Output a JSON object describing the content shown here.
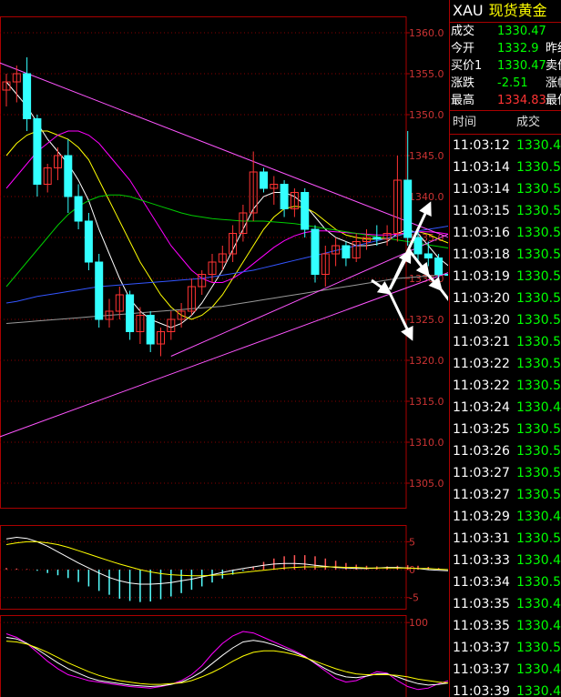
{
  "symbol": {
    "code": "XAU",
    "name": "现货黄金"
  },
  "quote": {
    "rows": [
      {
        "label": "成交",
        "value": "1330.47",
        "color": "#00ff00",
        "label2": ""
      },
      {
        "label": "今开",
        "value": "1332.9",
        "color": "#00ff00",
        "label2": "昨结"
      },
      {
        "label": "买价1",
        "value": "1330.47",
        "color": "#00ff00",
        "label2": "卖价"
      },
      {
        "label": "涨跌",
        "value": "-2.51",
        "color": "#00ff00",
        "label2": "涨幅"
      },
      {
        "label": "最高",
        "value": "1334.83",
        "color": "#ff3333",
        "label2": "最低"
      }
    ]
  },
  "ticks_header": {
    "time": "时间",
    "price": "成交"
  },
  "ticks": [
    {
      "time": "11:03:12",
      "price": "1330.4"
    },
    {
      "time": "11:03:14",
      "price": "1330.5"
    },
    {
      "time": "11:03:14",
      "price": "1330.5"
    },
    {
      "time": "11:03:15",
      "price": "1330.5"
    },
    {
      "time": "11:03:16",
      "price": "1330.5"
    },
    {
      "time": "11:03:18",
      "price": "1330.5"
    },
    {
      "time": "11:03:19",
      "price": "1330.5"
    },
    {
      "time": "11:03:20",
      "price": "1330.5"
    },
    {
      "time": "11:03:20",
      "price": "1330.5"
    },
    {
      "time": "11:03:21",
      "price": "1330.5"
    },
    {
      "time": "11:03:22",
      "price": "1330.5"
    },
    {
      "time": "11:03:22",
      "price": "1330.5"
    },
    {
      "time": "11:03:24",
      "price": "1330.4"
    },
    {
      "time": "11:03:25",
      "price": "1330.5"
    },
    {
      "time": "11:03:26",
      "price": "1330.5"
    },
    {
      "time": "11:03:27",
      "price": "1330.5"
    },
    {
      "time": "11:03:27",
      "price": "1330.5"
    },
    {
      "time": "11:03:29",
      "price": "1330.4"
    },
    {
      "time": "11:03:31",
      "price": "1330.5"
    },
    {
      "time": "11:03:33",
      "price": "1330.4"
    },
    {
      "time": "11:03:34",
      "price": "1330.5"
    },
    {
      "time": "11:03:35",
      "price": "1330.4"
    },
    {
      "time": "11:03:35",
      "price": "1330.4"
    },
    {
      "time": "11:03:37",
      "price": "1330.5"
    },
    {
      "time": "11:03:37",
      "price": "1330.4"
    },
    {
      "time": "11:03:39",
      "price": "1330.4"
    }
  ],
  "chart_data": [
    {
      "type": "candlestick",
      "ylim": [
        1302,
        1362
      ],
      "y_ticks": [
        "1360.0",
        "1355.0",
        "1350.0",
        "1345.0",
        "1340.0",
        "1335.0",
        "1330.0",
        "1325.0",
        "1320.0",
        "1315.0",
        "1310.0",
        "1305.0"
      ],
      "y_tick_values": [
        1360,
        1355,
        1350,
        1345,
        1340,
        1335,
        1330,
        1325,
        1320,
        1315,
        1310,
        1305
      ],
      "colors": {
        "up": "#ff3333",
        "down": "#33ffff"
      },
      "candles": [
        {
          "o": 1353.0,
          "h": 1355.0,
          "l": 1351.0,
          "c": 1354.0
        },
        {
          "o": 1354.0,
          "h": 1356.0,
          "l": 1351.5,
          "c": 1355.0
        },
        {
          "o": 1355.0,
          "h": 1357.0,
          "l": 1348.0,
          "c": 1349.5
        },
        {
          "o": 1349.5,
          "h": 1350.0,
          "l": 1340.0,
          "c": 1341.5
        },
        {
          "o": 1341.5,
          "h": 1344.0,
          "l": 1340.5,
          "c": 1343.5
        },
        {
          "o": 1343.5,
          "h": 1346.0,
          "l": 1342.0,
          "c": 1345.0
        },
        {
          "o": 1345.0,
          "h": 1347.0,
          "l": 1338.0,
          "c": 1340.0
        },
        {
          "o": 1340.0,
          "h": 1341.5,
          "l": 1336.0,
          "c": 1337.0
        },
        {
          "o": 1337.0,
          "h": 1338.0,
          "l": 1331.0,
          "c": 1332.0
        },
        {
          "o": 1332.0,
          "h": 1333.0,
          "l": 1324.0,
          "c": 1325.0
        },
        {
          "o": 1325.0,
          "h": 1327.5,
          "l": 1324.0,
          "c": 1326.0
        },
        {
          "o": 1326.0,
          "h": 1329.0,
          "l": 1325.0,
          "c": 1328.0
        },
        {
          "o": 1328.0,
          "h": 1328.5,
          "l": 1322.5,
          "c": 1323.5
        },
        {
          "o": 1323.5,
          "h": 1326.5,
          "l": 1322.0,
          "c": 1325.5
        },
        {
          "o": 1325.5,
          "h": 1326.0,
          "l": 1321.0,
          "c": 1322.0
        },
        {
          "o": 1322.0,
          "h": 1324.0,
          "l": 1320.5,
          "c": 1323.5
        },
        {
          "o": 1323.5,
          "h": 1326.0,
          "l": 1322.5,
          "c": 1325.0
        },
        {
          "o": 1325.0,
          "h": 1327.0,
          "l": 1324.0,
          "c": 1326.0
        },
        {
          "o": 1326.0,
          "h": 1330.0,
          "l": 1325.5,
          "c": 1329.0
        },
        {
          "o": 1329.0,
          "h": 1331.0,
          "l": 1328.0,
          "c": 1330.5
        },
        {
          "o": 1330.5,
          "h": 1333.0,
          "l": 1329.5,
          "c": 1332.0
        },
        {
          "o": 1332.0,
          "h": 1334.0,
          "l": 1331.0,
          "c": 1333.0
        },
        {
          "o": 1333.0,
          "h": 1336.5,
          "l": 1332.0,
          "c": 1335.5
        },
        {
          "o": 1335.5,
          "h": 1339.0,
          "l": 1334.5,
          "c": 1338.0
        },
        {
          "o": 1338.0,
          "h": 1345.5,
          "l": 1337.0,
          "c": 1343.0
        },
        {
          "o": 1343.0,
          "h": 1343.5,
          "l": 1340.5,
          "c": 1341.0
        },
        {
          "o": 1341.0,
          "h": 1342.5,
          "l": 1339.0,
          "c": 1341.5
        },
        {
          "o": 1341.5,
          "h": 1342.0,
          "l": 1337.5,
          "c": 1338.5
        },
        {
          "o": 1338.5,
          "h": 1341.0,
          "l": 1337.5,
          "c": 1340.5
        },
        {
          "o": 1340.5,
          "h": 1341.0,
          "l": 1335.0,
          "c": 1336.0
        },
        {
          "o": 1336.0,
          "h": 1336.5,
          "l": 1329.5,
          "c": 1330.5
        },
        {
          "o": 1330.5,
          "h": 1334.0,
          "l": 1329.0,
          "c": 1333.0
        },
        {
          "o": 1333.0,
          "h": 1335.0,
          "l": 1331.5,
          "c": 1334.0
        },
        {
          "o": 1334.0,
          "h": 1334.5,
          "l": 1331.5,
          "c": 1332.5
        },
        {
          "o": 1332.5,
          "h": 1335.5,
          "l": 1332.0,
          "c": 1334.5
        },
        {
          "o": 1334.5,
          "h": 1336.0,
          "l": 1333.5,
          "c": 1335.0
        },
        {
          "o": 1335.0,
          "h": 1336.5,
          "l": 1334.0,
          "c": 1334.8
        },
        {
          "o": 1334.8,
          "h": 1336.5,
          "l": 1334.0,
          "c": 1335.5
        },
        {
          "o": 1335.5,
          "h": 1345.0,
          "l": 1334.5,
          "c": 1342.0
        },
        {
          "o": 1342.0,
          "h": 1348.0,
          "l": 1334.0,
          "c": 1335.0
        },
        {
          "o": 1335.0,
          "h": 1336.0,
          "l": 1332.0,
          "c": 1333.0
        },
        {
          "o": 1333.0,
          "h": 1334.5,
          "l": 1331.5,
          "c": 1332.5
        },
        {
          "o": 1332.5,
          "h": 1333.0,
          "l": 1330.0,
          "c": 1330.5
        },
        {
          "o": 1330.5,
          "h": 1331.0,
          "l": 1330.0,
          "c": 1330.47
        }
      ],
      "ma_lines": [
        {
          "color": "#ffffff",
          "values": [
            1354,
            1352.5,
            1351,
            1349,
            1347,
            1345.5,
            1344,
            1342,
            1339.5,
            1336,
            1333,
            1330,
            1327.5,
            1326,
            1325,
            1324.5,
            1324,
            1324.5,
            1325.5,
            1327,
            1329,
            1331,
            1333.5,
            1336,
            1338.5,
            1340,
            1340.5,
            1340.5,
            1340,
            1339,
            1337.5,
            1336,
            1335,
            1334.5,
            1334,
            1334,
            1334.2,
            1334.5,
            1335.5,
            1336,
            1335.5,
            1334,
            1332.5,
            1331.5
          ]
        },
        {
          "color": "#ffff00",
          "values": [
            1345,
            1346.5,
            1347.5,
            1348,
            1348,
            1347.5,
            1347,
            1346,
            1344.5,
            1342,
            1339.5,
            1337,
            1334.5,
            1332,
            1330,
            1328,
            1326.5,
            1325.5,
            1325,
            1325.5,
            1326.5,
            1328,
            1330,
            1332,
            1334,
            1336,
            1337.5,
            1338.5,
            1338.8,
            1338.7,
            1338,
            1337,
            1336,
            1335.3,
            1335,
            1334.8,
            1334.8,
            1334.9,
            1335.2,
            1335.6,
            1335.7,
            1335.4,
            1334.8,
            1334.3
          ]
        },
        {
          "color": "#ff00ff",
          "values": [
            1341,
            1342.5,
            1344,
            1345.5,
            1346.5,
            1347.5,
            1348,
            1348,
            1347.5,
            1346.5,
            1345,
            1343.5,
            1342,
            1340,
            1338,
            1336,
            1334,
            1332.5,
            1331,
            1330,
            1329.5,
            1329.5,
            1330,
            1330.8,
            1331.8,
            1332.8,
            1333.8,
            1334.6,
            1335.2,
            1335.6,
            1335.8,
            1335.8,
            1335.7,
            1335.6,
            1335.5,
            1335.4,
            1335.3,
            1335.3,
            1335.4,
            1335.6,
            1335.7,
            1335.7,
            1335.6,
            1335.4
          ]
        },
        {
          "color": "#00cc00",
          "values": [
            1329,
            1330.5,
            1332,
            1333.5,
            1335,
            1336.5,
            1337.8,
            1338.8,
            1339.5,
            1340,
            1340.2,
            1340.2,
            1340,
            1339.6,
            1339.2,
            1338.8,
            1338.4,
            1338,
            1337.7,
            1337.5,
            1337.3,
            1337.2,
            1337.1,
            1337,
            1337,
            1337,
            1336.9,
            1336.8,
            1336.7,
            1336.5,
            1336.3,
            1336.1,
            1335.9,
            1335.7,
            1335.5,
            1335.3,
            1335.1,
            1334.9,
            1334.7,
            1334.5,
            1334.3,
            1334.1,
            1333.9,
            1333.7
          ]
        },
        {
          "color": "#3355ff",
          "values": [
            1327,
            1327.2,
            1327.5,
            1327.8,
            1328,
            1328.2,
            1328.4,
            1328.6,
            1328.8,
            1329,
            1329.1,
            1329.2,
            1329.3,
            1329.4,
            1329.5,
            1329.6,
            1329.7,
            1329.8,
            1329.9,
            1330,
            1330.2,
            1330.4,
            1330.6,
            1330.8,
            1331,
            1331.3,
            1331.6,
            1331.9,
            1332.2,
            1332.5,
            1332.8,
            1333.1,
            1333.4,
            1333.7,
            1334,
            1334.3,
            1334.6,
            1334.9,
            1335.2,
            1335.5,
            1335.8,
            1336,
            1336.2,
            1336.4
          ]
        },
        {
          "color": "#999999",
          "values": [
            1324.5,
            1324.6,
            1324.7,
            1324.8,
            1324.9,
            1325,
            1325.1,
            1325.2,
            1325.3,
            1325.4,
            1325.5,
            1325.6,
            1325.7,
            1325.8,
            1325.9,
            1326,
            1326.1,
            1326.2,
            1326.3,
            1326.4,
            1326.5,
            1326.6,
            1326.8,
            1327,
            1327.2,
            1327.4,
            1327.6,
            1327.8,
            1328,
            1328.2,
            1328.4,
            1328.6,
            1328.8,
            1329,
            1329.2,
            1329.4,
            1329.6,
            1329.8,
            1330,
            1330.1,
            1330.2,
            1330.3,
            1330.4,
            1330.5
          ]
        }
      ],
      "trend_lines": [
        {
          "from": [
            -1,
            1356.5
          ],
          "to": [
            44,
            1334.5
          ],
          "color": "#ff55ff"
        },
        {
          "from": [
            -1,
            1310.5
          ],
          "to": [
            44,
            1331.2
          ],
          "color": "#ff55ff"
        },
        {
          "from": [
            16,
            1320.5
          ],
          "to": [
            44,
            1336.0
          ],
          "color": "#ff55ff"
        }
      ]
    },
    {
      "type": "macd",
      "ylim": [
        -7,
        8
      ],
      "y_ticks": [
        "5",
        "0",
        "-5"
      ],
      "y_tick_values": [
        5,
        0,
        -5
      ],
      "bars": [
        0.3,
        0.2,
        0.1,
        -0.2,
        -0.6,
        -1,
        -1.5,
        -2.2,
        -3,
        -3.8,
        -4.5,
        -5.2,
        -5.6,
        -5.8,
        -5.7,
        -5.3,
        -4.8,
        -4.2,
        -3.6,
        -3,
        -2.3,
        -1.6,
        -0.9,
        -0.2,
        0.6,
        1.4,
        2,
        2.4,
        2.6,
        2.6,
        2.4,
        2,
        1.6,
        1.2,
        0.9,
        0.7,
        0.6,
        0.6,
        0.7,
        0.8,
        0.7,
        0.5,
        0.3,
        0.1
      ],
      "lines": [
        {
          "color": "#ffffff",
          "values": [
            5.5,
            5.8,
            5.6,
            5,
            4.2,
            3.2,
            2.2,
            1.2,
            0.3,
            -0.6,
            -1.4,
            -2,
            -2.4,
            -2.6,
            -2.6,
            -2.5,
            -2.3,
            -2,
            -1.7,
            -1.3,
            -0.9,
            -0.5,
            -0.1,
            0.2,
            0.5,
            0.8,
            1,
            1.1,
            1.1,
            1,
            0.8,
            0.6,
            0.4,
            0.3,
            0.2,
            0.2,
            0.3,
            0.4,
            0.4,
            0.3,
            0.2,
            0,
            -0.1,
            -0.2
          ]
        },
        {
          "color": "#ffff00",
          "values": [
            4.5,
            4.8,
            5,
            5,
            4.8,
            4.5,
            4,
            3.4,
            2.8,
            2.2,
            1.6,
            1,
            0.5,
            0,
            -0.4,
            -0.7,
            -0.9,
            -1,
            -1.1,
            -1.1,
            -1,
            -0.9,
            -0.7,
            -0.5,
            -0.3,
            -0.1,
            0.1,
            0.3,
            0.4,
            0.5,
            0.5,
            0.5,
            0.5,
            0.4,
            0.4,
            0.3,
            0.3,
            0.3,
            0.3,
            0.3,
            0.2,
            0.2,
            0.1,
            0
          ]
        }
      ]
    },
    {
      "type": "line",
      "ylim": [
        0,
        110
      ],
      "y_ticks": [
        "100"
      ],
      "y_tick_values": [
        100
      ],
      "lines": [
        {
          "color": "#ff00ff",
          "values": [
            85,
            80,
            72,
            60,
            48,
            38,
            30,
            26,
            22,
            20,
            18,
            16,
            14,
            13,
            12,
            14,
            17,
            22,
            30,
            42,
            58,
            72,
            82,
            88,
            86,
            80,
            74,
            68,
            62,
            55,
            45,
            35,
            25,
            20,
            22,
            28,
            34,
            32,
            22,
            14,
            10,
            12,
            18,
            22
          ]
        },
        {
          "color": "#ffffff",
          "values": [
            80,
            78,
            72,
            64,
            55,
            46,
            38,
            32,
            26,
            22,
            20,
            18,
            16,
            15,
            14,
            15,
            17,
            20,
            26,
            34,
            45,
            56,
            66,
            74,
            76,
            74,
            70,
            65,
            60,
            54,
            46,
            38,
            31,
            27,
            26,
            28,
            31,
            31,
            27,
            22,
            18,
            16,
            17,
            19
          ]
        },
        {
          "color": "#ffff00",
          "values": [
            75,
            74,
            71,
            66,
            60,
            53,
            46,
            40,
            34,
            29,
            25,
            22,
            20,
            18,
            17,
            17,
            18,
            19,
            22,
            27,
            33,
            40,
            48,
            55,
            60,
            62,
            62,
            60,
            57,
            53,
            48,
            43,
            38,
            34,
            31,
            30,
            30,
            30,
            29,
            27,
            24,
            22,
            20,
            19
          ]
        }
      ]
    }
  ]
}
